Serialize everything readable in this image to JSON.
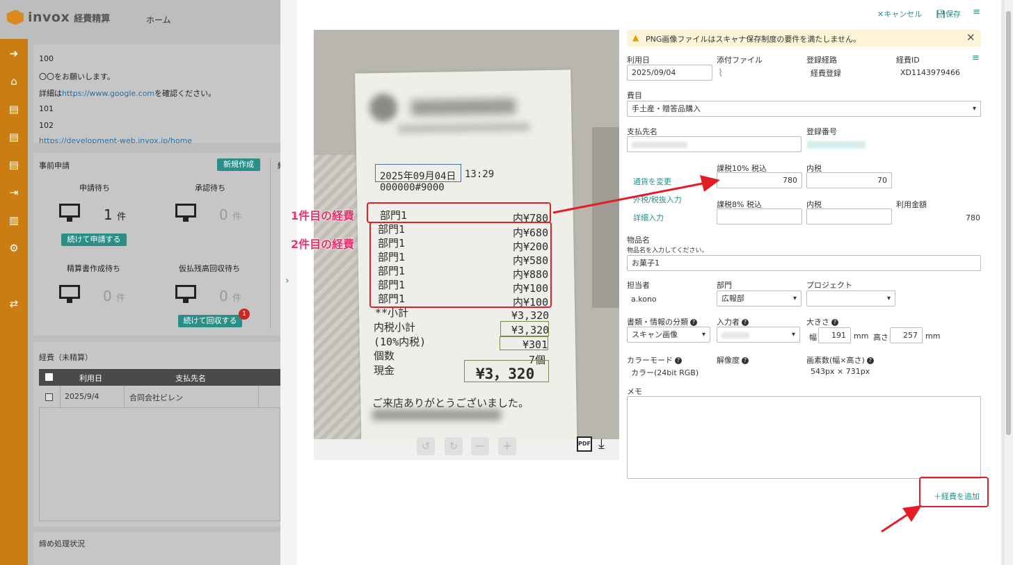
{
  "app": {
    "logo_text": "invox",
    "logo_sub": "経費精算",
    "home": "ホーム"
  },
  "notice_lines": [
    "100",
    "〇〇をお願いします。",
    "詳細は",
    "https://www.google.com",
    "を確認ください。",
    "101",
    "102",
    "https://development-web.invox.jp/home"
  ],
  "pre_apply": {
    "title": "事前申請",
    "new_button": "新規作成",
    "waiting_apply": "申請待ち",
    "waiting_apply_count": "1",
    "waiting_approve": "承認待ち",
    "waiting_approve_count": "0",
    "continue_apply": "続けて申請する",
    "waiting_settle": "精算書作成待ち",
    "waiting_settle_count": "0",
    "waiting_collect": "仮払残高回収待ち",
    "waiting_collect_count": "0",
    "continue_collect": "続けて回収する",
    "collect_badge": "1",
    "unit": "件",
    "side_label": "経"
  },
  "expenses_list": {
    "title": "経費（未精算）",
    "col_date": "利用日",
    "col_payee": "支払先名",
    "rows": [
      {
        "date": "2025/9/4",
        "payee": "合同会社ビレン"
      }
    ]
  },
  "closing": {
    "title": "締め処理状況"
  },
  "toolbar": {
    "cancel": "キャンセル",
    "save": "保存"
  },
  "warning": "PNG画像ファイルはスキャナ保存制度の要件を満たしません。",
  "form": {
    "use_date_label": "利用日",
    "use_date": "2025/09/04",
    "attach_label": "添付ファイル",
    "route_label": "登録経路",
    "route": "経費登録",
    "expense_id_label": "経費ID",
    "expense_id": "XD1143979466",
    "category_label": "費目",
    "category": "手土産・贈答品購入",
    "payee_label": "支払先名",
    "reg_no_label": "登録番号",
    "currency_link": "通貨を変更",
    "tax_excl_link": "外税/税抜入力",
    "detail_link": "詳細入力",
    "tax10_label": "課税10% 税込",
    "tax10_value": "780",
    "inner_tax_label": "内税",
    "inner_tax10_value": "70",
    "tax8_label": "課税8% 税込",
    "inner_tax8_label": "内税",
    "total_label": "利用金額",
    "total_value": "780",
    "item_label": "物品名",
    "item_hint": "物品名を入力してください。",
    "item_value": "お菓子1",
    "person_label": "担当者",
    "person": "a.kono",
    "dept_label": "部門",
    "dept": "広報部",
    "project_label": "プロジェクト",
    "doc_type_label": "書類・情報の分類",
    "doc_type": "スキャン画像",
    "entered_by_label": "入力者",
    "size_label": "大きさ",
    "width_label": "幅",
    "width_value": "191",
    "height_label": "高さ",
    "height_value": "257",
    "mm": "mm",
    "color_mode_label": "カラーモード",
    "color_mode": "カラー(24bit RGB)",
    "resolution_label": "解像度",
    "pixels_label": "画素数(幅×高さ)",
    "pixels": "543px × 731px",
    "memo_label": "メモ",
    "add_expense": "＋経費を追加"
  },
  "receipt": {
    "date": "2025年09月04日",
    "time": "13:29",
    "number": "000000#9000",
    "rows": [
      {
        "label": "部門1",
        "amount": "内¥780"
      },
      {
        "label": "部門1",
        "amount": "内¥680"
      },
      {
        "label": "部門1",
        "amount": "内¥200"
      },
      {
        "label": "部門1",
        "amount": "内¥580"
      },
      {
        "label": "部門1",
        "amount": "内¥880"
      },
      {
        "label": "部門1",
        "amount": "内¥100"
      },
      {
        "label": "部門1",
        "amount": "内¥100"
      }
    ],
    "subtotal_label": "**小計",
    "subtotal": "¥3,320",
    "inner_subtotal_label": "内税小計",
    "inner_subtotal": "¥3,320",
    "tax_label": "(10%内税)",
    "tax": "¥301",
    "count_label": "個数",
    "count": "7個",
    "cash_label": "現金",
    "cash": "¥3，320",
    "thanks": "ご来店ありがとうございました。"
  },
  "annotations": {
    "first": "1件目の経費",
    "second": "2件目の経費"
  },
  "image_tools": {
    "pdf": "PDF"
  }
}
